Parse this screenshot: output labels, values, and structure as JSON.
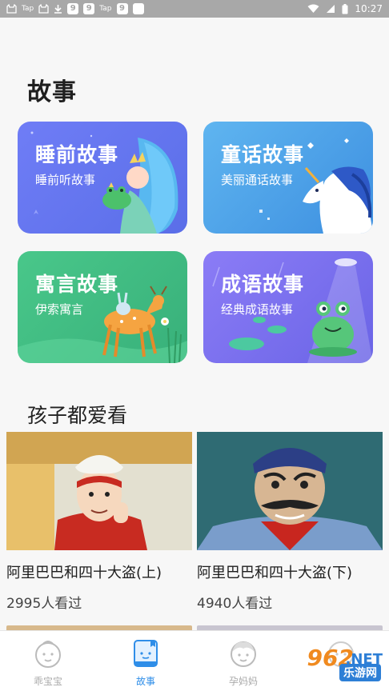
{
  "status_bar": {
    "left_icons": [
      "cat-icon",
      "tap-icon",
      "cat-icon",
      "download-icon",
      "9-icon",
      "9-icon",
      "tap-icon",
      "9-icon",
      "blank-icon"
    ],
    "tap_label": "Tap",
    "nine_label": "9",
    "time": "10:27"
  },
  "section": {
    "title": "故事"
  },
  "categories": [
    {
      "title": "睡前故事",
      "subtitle": "睡前听故事"
    },
    {
      "title": "童话故事",
      "subtitle": "美丽通话故事"
    },
    {
      "title": "寓言故事",
      "subtitle": "伊索寓言"
    },
    {
      "title": "成语故事",
      "subtitle": "经典成语故事"
    }
  ],
  "kids": {
    "title": "孩子都爱看",
    "videos": [
      {
        "title": "阿里巴巴和四十大盗(上)",
        "views": "2995",
        "views_suffix": "人看过"
      },
      {
        "title": "阿里巴巴和四十大盗(下)",
        "views": "4940",
        "views_suffix": "人看过"
      }
    ]
  },
  "tabbar": {
    "tabs": [
      {
        "label": "乖宝宝",
        "icon": "baby-face-icon",
        "active": false
      },
      {
        "label": "故事",
        "icon": "book-icon",
        "active": true
      },
      {
        "label": "孕妈妈",
        "icon": "mom-face-icon",
        "active": false
      },
      {
        "label": "",
        "icon": "face-icon",
        "active": false
      }
    ]
  },
  "watermark": {
    "brand": "962",
    "net": ".NET",
    "site": "乐游网"
  },
  "colors": {
    "accent": "#2f8ee8",
    "status_bar": "#a8a8a8"
  }
}
